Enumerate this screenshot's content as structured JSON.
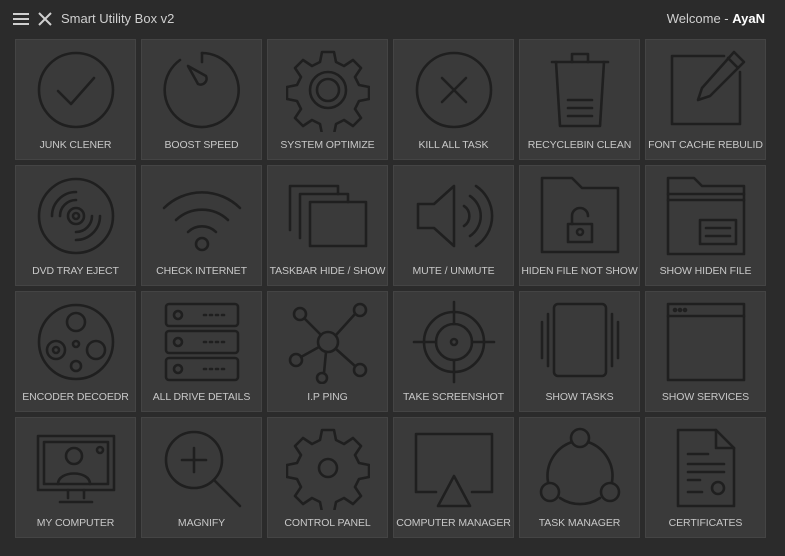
{
  "app": {
    "title": "Smart Utility Box v2"
  },
  "welcome": {
    "prefix": "Welcome - ",
    "user": "AyaN"
  },
  "tiles": [
    {
      "label": "JUNK CLENER",
      "icon": "check-circle-icon"
    },
    {
      "label": "BOOST SPEED",
      "icon": "speedometer-icon"
    },
    {
      "label": "SYSTEM OPTIMIZE",
      "icon": "gear-icon"
    },
    {
      "label": "KILL ALL TASK",
      "icon": "x-circle-icon"
    },
    {
      "label": "RECYCLEBIN CLEAN",
      "icon": "trash-icon"
    },
    {
      "label": "FONT CACHE REBULID",
      "icon": "pencil-square-icon"
    },
    {
      "label": "DVD TRAY EJECT",
      "icon": "disc-icon"
    },
    {
      "label": "CHECK INTERNET",
      "icon": "wifi-icon"
    },
    {
      "label": "TASKBAR HIDE / SHOW",
      "icon": "windows-stack-icon"
    },
    {
      "label": "MUTE / UNMUTE",
      "icon": "speaker-icon"
    },
    {
      "label": "HIDEN FILE NOT SHOW",
      "icon": "locked-folder-icon"
    },
    {
      "label": "SHOW HIDEN FILE",
      "icon": "open-folder-icon"
    },
    {
      "label": "ENCODER DECOEDR",
      "icon": "film-reel-icon"
    },
    {
      "label": "ALL DRIVE DETAILS",
      "icon": "server-icon"
    },
    {
      "label": "I.P PING",
      "icon": "network-icon"
    },
    {
      "label": "TAKE SCREENSHOT",
      "icon": "crosshair-icon"
    },
    {
      "label": "SHOW TASKS",
      "icon": "tasks-stack-icon"
    },
    {
      "label": "SHOW SERVICES",
      "icon": "browser-window-icon"
    },
    {
      "label": "MY COMPUTER",
      "icon": "monitor-user-icon"
    },
    {
      "label": "MAGNIFY",
      "icon": "magnifier-plus-icon"
    },
    {
      "label": "CONTROL PANEL",
      "icon": "cog-icon"
    },
    {
      "label": "COMPUTER MANAGER",
      "icon": "screen-cast-icon"
    },
    {
      "label": "TASK MANAGER",
      "icon": "cycle-nodes-icon"
    },
    {
      "label": "CERTIFICATES",
      "icon": "certificate-icon"
    }
  ]
}
